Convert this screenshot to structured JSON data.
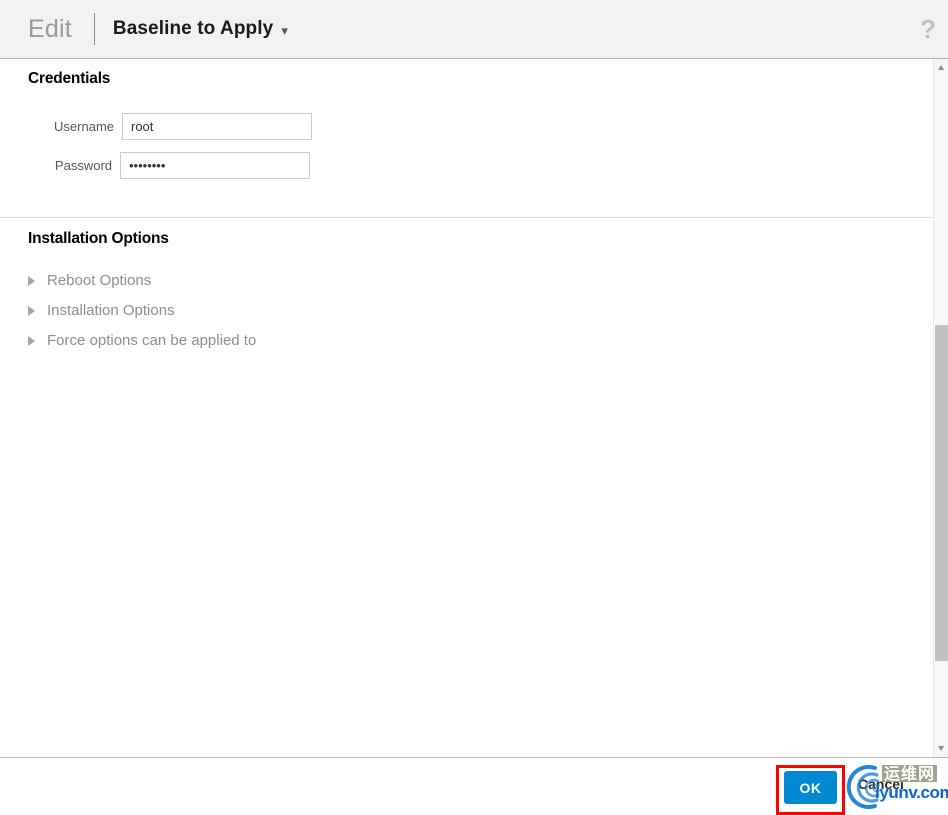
{
  "header": {
    "edit_label": "Edit",
    "title": "Baseline to Apply",
    "caret_icon": "chevron-down-icon",
    "help_icon": "?"
  },
  "credentials": {
    "heading": "Credentials",
    "username": {
      "label": "Username",
      "value": "root",
      "placeholder": ""
    },
    "password": {
      "label": "Password",
      "value": "••••••••",
      "masked_char_count": 8,
      "placeholder": ""
    }
  },
  "installation": {
    "heading": "Installation Options",
    "items": [
      {
        "label": "Reboot Options",
        "expanded": false
      },
      {
        "label": "Installation Options",
        "expanded": false
      },
      {
        "label": "Force options can be applied to",
        "expanded": false
      }
    ]
  },
  "footer": {
    "ok_label": "OK",
    "cancel_label": "Cancel"
  },
  "scrollbar": {
    "up_arrow": "scroll-up-arrow-icon",
    "down_arrow": "scroll-down-arrow-icon"
  },
  "watermark": {
    "chinese_text": "运维网",
    "domain_text": "iyunv.com"
  },
  "colors": {
    "accent_blue": "#0088d1",
    "annotation_red": "#ff0000",
    "header_bg": "#f2f2f2",
    "muted_text": "#8f8f8f"
  }
}
